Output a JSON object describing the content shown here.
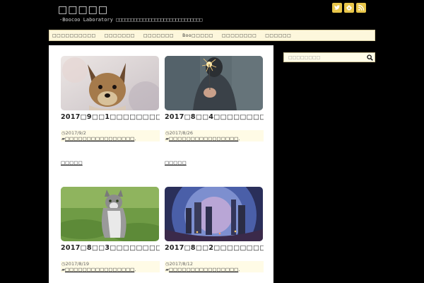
{
  "header": {
    "site_title": "□□□□□",
    "site_desc": "-Boocoo Laboratory □□□□□□□□□□□□□□□□□□□□□□□□□□□□□",
    "social": [
      {
        "name": "twitter-icon",
        "color": "#e8c64a"
      },
      {
        "name": "feedly-icon",
        "color": "#e8c64a"
      },
      {
        "name": "rss-icon",
        "color": "#e8c64a"
      }
    ]
  },
  "nav": {
    "items": [
      "□□□□□□□□□□",
      "□□□□□□□",
      "□□□□□□□",
      "Boo□□□□□",
      "□□□□□□□□",
      "□□□□□□"
    ]
  },
  "posts": [
    {
      "title": "2017□9□□1□□□□□□□□□□□□□□□□□□□□□□□□□",
      "date": "2017/9/2",
      "category": "□□□□□□□□□□□□□□□□",
      "category2": "□□□□□□□□",
      "readmore": "□□□□□"
    },
    {
      "title": "2017□8□□4□□□□□□□□□□□□□□□□□□□□□□□□□",
      "date": "2017/8/26",
      "category": "□□□□□□□□□□□□□□□□",
      "category2": "□□□□□□□□",
      "readmore": "□□□□□"
    },
    {
      "title": "2017□8□□3□□□□□□□□□□□□□□□□□□□□□□□□□",
      "date": "2017/8/19",
      "category": "□□□□□□□□□□□□□□□□",
      "category2": "□□□□□□□□"
    },
    {
      "title": "2017□8□□2□□□□□□□□□□□□□□□□□□□□□□□□□",
      "date": "2017/8/12",
      "category": "□□□□□□□□□□□□□□□□",
      "category2": "□□□□□□□□"
    }
  ],
  "sidebar": {
    "search_placeholder": "□□□□□□□□",
    "search_icon": "search-icon"
  }
}
